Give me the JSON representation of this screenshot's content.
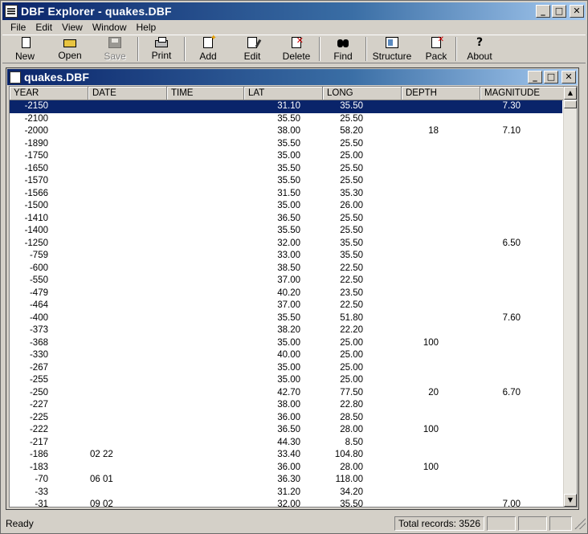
{
  "window": {
    "title": "DBF Explorer - quakes.DBF",
    "controls": {
      "minimize": "_",
      "maximize": "□",
      "close": "✕"
    }
  },
  "menu": [
    "File",
    "Edit",
    "View",
    "Window",
    "Help"
  ],
  "toolbar": {
    "new": "New",
    "open": "Open",
    "save": "Save",
    "print": "Print",
    "add": "Add",
    "edit": "Edit",
    "delete": "Delete",
    "find": "Find",
    "structure": "Structure",
    "pack": "Pack",
    "about": "About"
  },
  "child_window": {
    "title": "quakes.DBF"
  },
  "table": {
    "columns": [
      "YEAR",
      "DATE",
      "TIME",
      "LAT",
      "LONG",
      "DEPTH",
      "MAGNITUDE"
    ],
    "selected_row": 0,
    "rows": [
      [
        "-2150",
        "",
        "",
        "31.10",
        "35.50",
        "",
        "7.30"
      ],
      [
        "-2100",
        "",
        "",
        "35.50",
        "25.50",
        "",
        ""
      ],
      [
        "-2000",
        "",
        "",
        "38.00",
        "58.20",
        "18",
        "7.10"
      ],
      [
        "-1890",
        "",
        "",
        "35.50",
        "25.50",
        "",
        ""
      ],
      [
        "-1750",
        "",
        "",
        "35.00",
        "25.00",
        "",
        ""
      ],
      [
        "-1650",
        "",
        "",
        "35.50",
        "25.50",
        "",
        ""
      ],
      [
        "-1570",
        "",
        "",
        "35.50",
        "25.50",
        "",
        ""
      ],
      [
        "-1566",
        "",
        "",
        "31.50",
        "35.30",
        "",
        ""
      ],
      [
        "-1500",
        "",
        "",
        "35.00",
        "26.00",
        "",
        ""
      ],
      [
        "-1410",
        "",
        "",
        "36.50",
        "25.50",
        "",
        ""
      ],
      [
        "-1400",
        "",
        "",
        "35.50",
        "25.50",
        "",
        ""
      ],
      [
        "-1250",
        "",
        "",
        "32.00",
        "35.50",
        "",
        "6.50"
      ],
      [
        "-759",
        "",
        "",
        "33.00",
        "35.50",
        "",
        ""
      ],
      [
        "-600",
        "",
        "",
        "38.50",
        "22.50",
        "",
        ""
      ],
      [
        "-550",
        "",
        "",
        "37.00",
        "22.50",
        "",
        ""
      ],
      [
        "-479",
        "",
        "",
        "40.20",
        "23.50",
        "",
        ""
      ],
      [
        "-464",
        "",
        "",
        "37.00",
        "22.50",
        "",
        ""
      ],
      [
        "-400",
        "",
        "",
        "35.50",
        "51.80",
        "",
        "7.60"
      ],
      [
        "-373",
        "",
        "",
        "38.20",
        "22.20",
        "",
        ""
      ],
      [
        "-368",
        "",
        "",
        "35.00",
        "25.00",
        "100",
        ""
      ],
      [
        "-330",
        "",
        "",
        "40.00",
        "25.00",
        "",
        ""
      ],
      [
        "-267",
        "",
        "",
        "35.00",
        "25.00",
        "",
        ""
      ],
      [
        "-255",
        "",
        "",
        "35.00",
        "25.00",
        "",
        ""
      ],
      [
        "-250",
        "",
        "",
        "42.70",
        "77.50",
        "20",
        "6.70"
      ],
      [
        "-227",
        "",
        "",
        "38.00",
        "22.80",
        "",
        ""
      ],
      [
        "-225",
        "",
        "",
        "36.00",
        "28.50",
        "",
        ""
      ],
      [
        "-222",
        "",
        "",
        "36.50",
        "28.00",
        "100",
        ""
      ],
      [
        "-217",
        "",
        "",
        "44.30",
        "8.50",
        "",
        ""
      ],
      [
        "-186",
        "02 22",
        "",
        "33.40",
        "104.80",
        "",
        ""
      ],
      [
        "-183",
        "",
        "",
        "36.00",
        "28.00",
        "100",
        ""
      ],
      [
        "-70",
        "06 01",
        "",
        "36.30",
        "118.00",
        "",
        ""
      ],
      [
        "-33",
        "",
        "",
        "31.20",
        "34.20",
        "",
        ""
      ],
      [
        "-31",
        "09 02",
        "",
        "32.00",
        "35.50",
        "",
        "7.00"
      ]
    ]
  },
  "scrollbar": {
    "up": "▲",
    "down": "▼"
  },
  "status": {
    "ready": "Ready",
    "total_records": "Total records: 3526"
  }
}
